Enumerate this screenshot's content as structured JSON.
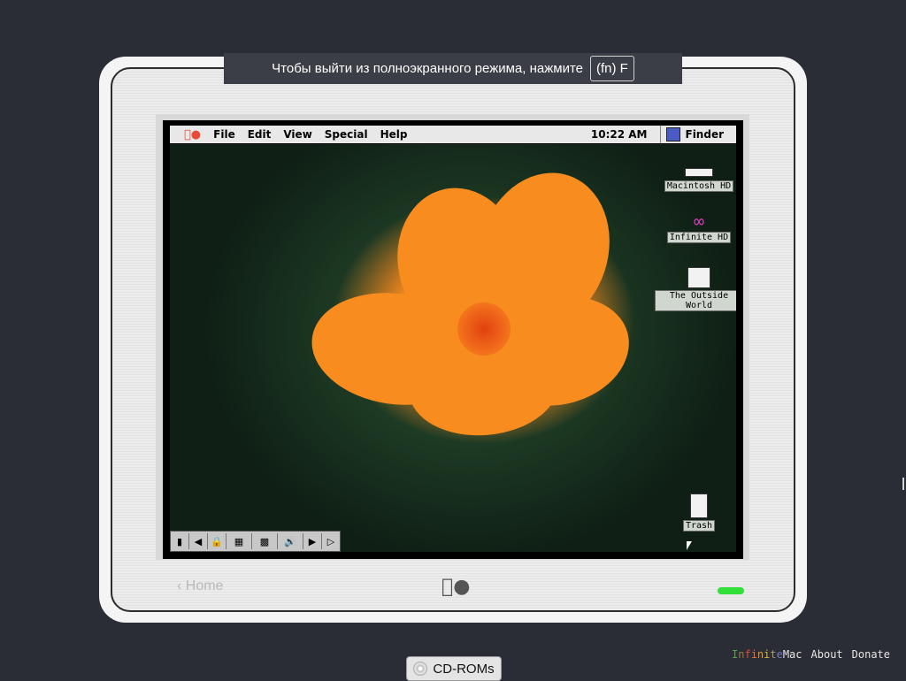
{
  "fullscreen_banner": {
    "message": "Чтобы выйти из полноэкранного режима, нажмите",
    "key": "(fn) F"
  },
  "menubar": {
    "items": [
      "File",
      "Edit",
      "View",
      "Special",
      "Help"
    ],
    "clock": "10:22 AM",
    "app": "Finder"
  },
  "desktop_icons": [
    {
      "label": "Macintosh HD",
      "icon": "hard-drive-icon"
    },
    {
      "label": "Infinite HD",
      "icon": "infinite-hd-icon"
    },
    {
      "label": "The Outside World",
      "icon": "network-globe-icon"
    },
    {
      "label": "Trash",
      "icon": "trash-icon"
    }
  ],
  "bezel": {
    "home_label": "‹ Home",
    "power_led_color": "#32e03a"
  },
  "bottom": {
    "cdrom_label": "CD-ROMs",
    "brand_part1": "Infinite",
    "brand_part2": "Mac",
    "about": "About",
    "donate": "Donate"
  },
  "colors": {
    "page_bg": "#2a2d35",
    "flower": "#f98c1f",
    "led": "#32e03a"
  }
}
